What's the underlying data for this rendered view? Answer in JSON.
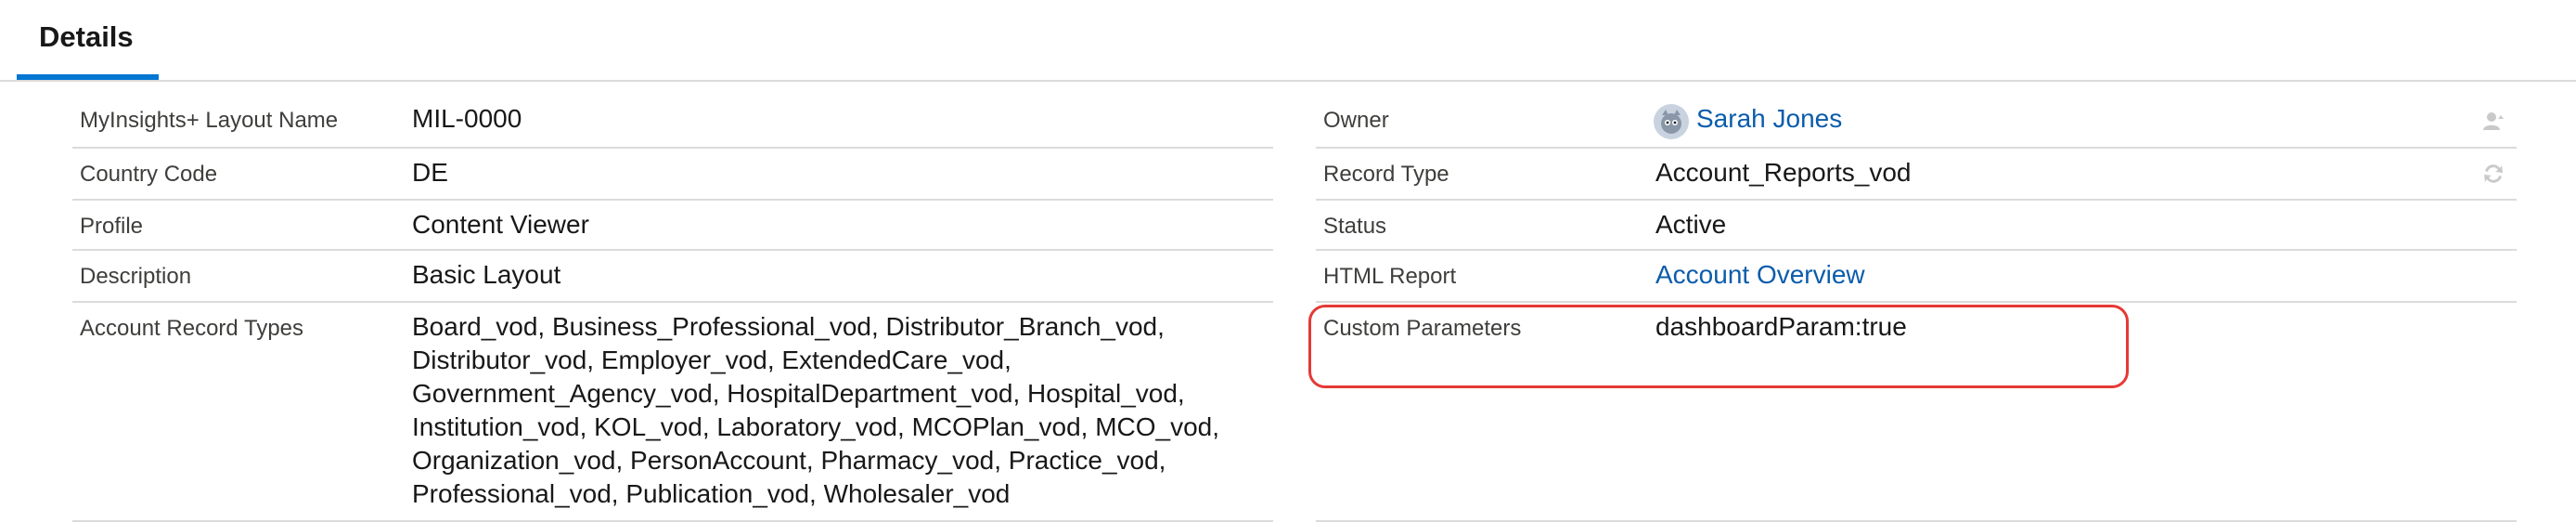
{
  "tabs": {
    "details": "Details"
  },
  "left_fields": [
    {
      "label": "MyInsights+ Layout Name",
      "value": "MIL-0000"
    },
    {
      "label": "Country Code",
      "value": "DE"
    },
    {
      "label": "Profile",
      "value": "Content Viewer"
    },
    {
      "label": "Description",
      "value": "Basic Layout"
    },
    {
      "label": "Account Record Types",
      "value": "Board_vod, Business_Professional_vod, Distributor_Branch_vod, Distributor_vod, Employer_vod, ExtendedCare_vod, Government_Agency_vod, HospitalDepartment_vod, Hospital_vod, Institution_vod, KOL_vod, Laboratory_vod, MCOPlan_vod, MCO_vod, Organization_vod, PersonAccount, Pharmacy_vod, Practice_vod, Professional_vod, Publication_vod, Wholesaler_vod"
    }
  ],
  "right_fields": [
    {
      "label": "Owner",
      "value": "Sarah Jones",
      "icon": "change-owner-icon"
    },
    {
      "label": "Record Type",
      "value": "Account_Reports_vod",
      "icon": "change-record-type-icon"
    },
    {
      "label": "Status",
      "value": "Active"
    },
    {
      "label": "HTML Report",
      "value": "Account Overview"
    },
    {
      "label": "Custom Parameters",
      "value": "dashboardParam:true"
    }
  ],
  "colors": {
    "accent": "#0176d3",
    "link": "#0b5cab",
    "highlight": "#e53935",
    "divider": "#dddbda"
  }
}
